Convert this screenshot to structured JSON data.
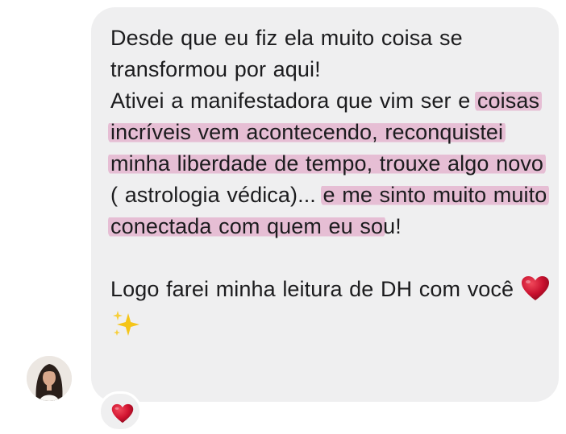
{
  "message": {
    "paragraph1": "Desde que eu fiz ela muito coisa se transformou por aqui!",
    "paragraph2": {
      "part1": "Ativei a manifestadora que vim ser e ",
      "highlight1": "coisas incríveis vem acontecendo, reconquistei minha liberdade de tempo, trouxe algo novo",
      "part2": " ( astrologia védica)... ",
      "highlight2": "e me sinto muito muito conectada com quem eu so",
      "part3": "u!"
    },
    "paragraph3": "Logo farei minha leitura de DH com você"
  },
  "icons": {
    "heart": "red-heart-icon",
    "sparkles": "sparkles-icon",
    "reaction": "heart-reaction-icon",
    "avatar": "profile-avatar"
  },
  "colors": {
    "bubble": "#efeff0",
    "highlight": "#de96be",
    "heart": "#c8102e",
    "sparkles": "#f5c518"
  }
}
